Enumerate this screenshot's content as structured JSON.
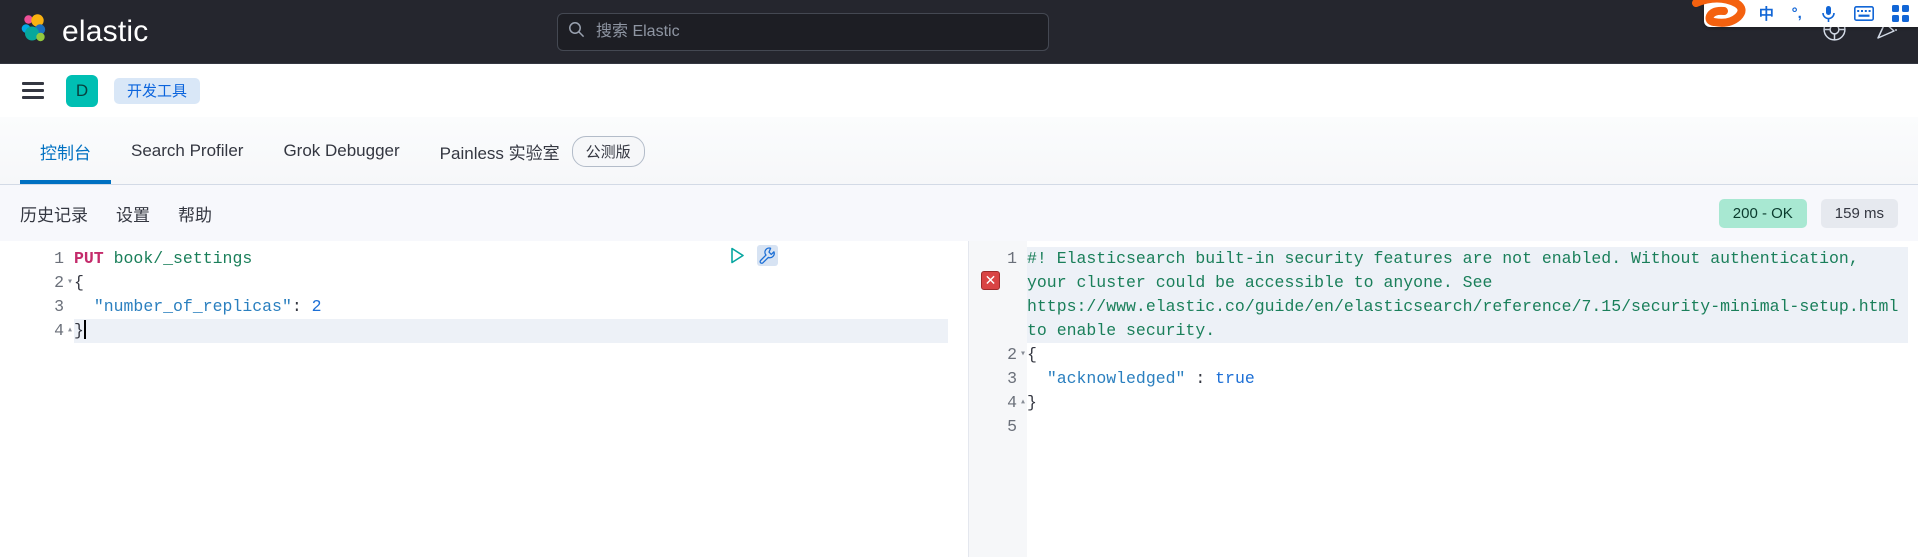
{
  "ime": {
    "logo": "sogou-logo-icon",
    "items": [
      {
        "name": "chinese-mode-icon",
        "label": "中"
      },
      {
        "name": "punctuation-mode-icon",
        "label": "°,"
      },
      {
        "name": "voice-input-icon",
        "label": ""
      },
      {
        "name": "soft-keyboard-icon",
        "label": ""
      },
      {
        "name": "toolbox-icon",
        "label": ""
      }
    ]
  },
  "header": {
    "brand": "elastic",
    "search": {
      "placeholder": "搜索 Elastic",
      "value": ""
    },
    "icons": [
      {
        "name": "help-icon"
      },
      {
        "name": "news-feed-icon"
      }
    ]
  },
  "breadcrumb": {
    "menu_label": "menu",
    "space_initial": "D",
    "items": [
      "开发工具"
    ]
  },
  "tabs": [
    {
      "label": "控制台",
      "active": true
    },
    {
      "label": "Search Profiler",
      "active": false
    },
    {
      "label": "Grok Debugger",
      "active": false
    },
    {
      "label": "Painless 实验室",
      "active": false,
      "badge": "公测版"
    }
  ],
  "console_toolbar": {
    "links": [
      "历史记录",
      "设置",
      "帮助"
    ],
    "status": "200 - OK",
    "duration": "159 ms"
  },
  "request_editor": {
    "actions": [
      {
        "name": "send-request-icon"
      },
      {
        "name": "wrench-icon"
      }
    ],
    "lines": [
      {
        "n": "1",
        "fold": "",
        "tokens": [
          {
            "t": "PUT",
            "c": "tok-method"
          },
          {
            "t": " ",
            "c": "tok-plain"
          },
          {
            "t": "book/_settings",
            "c": "tok-path"
          }
        ]
      },
      {
        "n": "2",
        "fold": "▾",
        "tokens": [
          {
            "t": "{",
            "c": "tok-punct"
          }
        ]
      },
      {
        "n": "3",
        "fold": "",
        "tokens": [
          {
            "t": "  ",
            "c": "tok-plain"
          },
          {
            "t": "\"number_of_replicas\"",
            "c": "tok-key"
          },
          {
            "t": ": ",
            "c": "tok-punct"
          },
          {
            "t": "2",
            "c": "tok-num"
          }
        ]
      },
      {
        "n": "4",
        "fold": "▴",
        "tokens": [
          {
            "t": "}",
            "c": "tok-punct"
          }
        ],
        "cursor": true,
        "highlight": true
      }
    ]
  },
  "response_editor": {
    "error_marker": "✕",
    "lines": [
      {
        "n": "1",
        "fold": "",
        "wrapped": true,
        "highlight": true,
        "tokens": [
          {
            "t": "#! Elasticsearch built-in security features are not enabled. Without authentication, your cluster could be accessible to anyone. See https://www.elastic.co/guide/en/elasticsearch/reference/7.15/security-minimal-setup.html to enable security.",
            "c": "tok-warn"
          }
        ]
      },
      {
        "n": "2",
        "fold": "▾",
        "tokens": [
          {
            "t": "{",
            "c": "tok-punct"
          }
        ]
      },
      {
        "n": "3",
        "fold": "",
        "tokens": [
          {
            "t": "  ",
            "c": "tok-plain"
          },
          {
            "t": "\"acknowledged\"",
            "c": "tok-key"
          },
          {
            "t": " : ",
            "c": "tok-punct"
          },
          {
            "t": "true",
            "c": "tok-bool"
          }
        ]
      },
      {
        "n": "4",
        "fold": "▴",
        "tokens": [
          {
            "t": "}",
            "c": "tok-punct"
          }
        ]
      },
      {
        "n": "5",
        "fold": "",
        "tokens": []
      }
    ]
  },
  "colors": {
    "header_bg": "#25262e",
    "accent": "#0071c2",
    "space_avatar": "#00bfb3",
    "success_badge": "#a8e8d2",
    "error_marker": "#d94444"
  }
}
